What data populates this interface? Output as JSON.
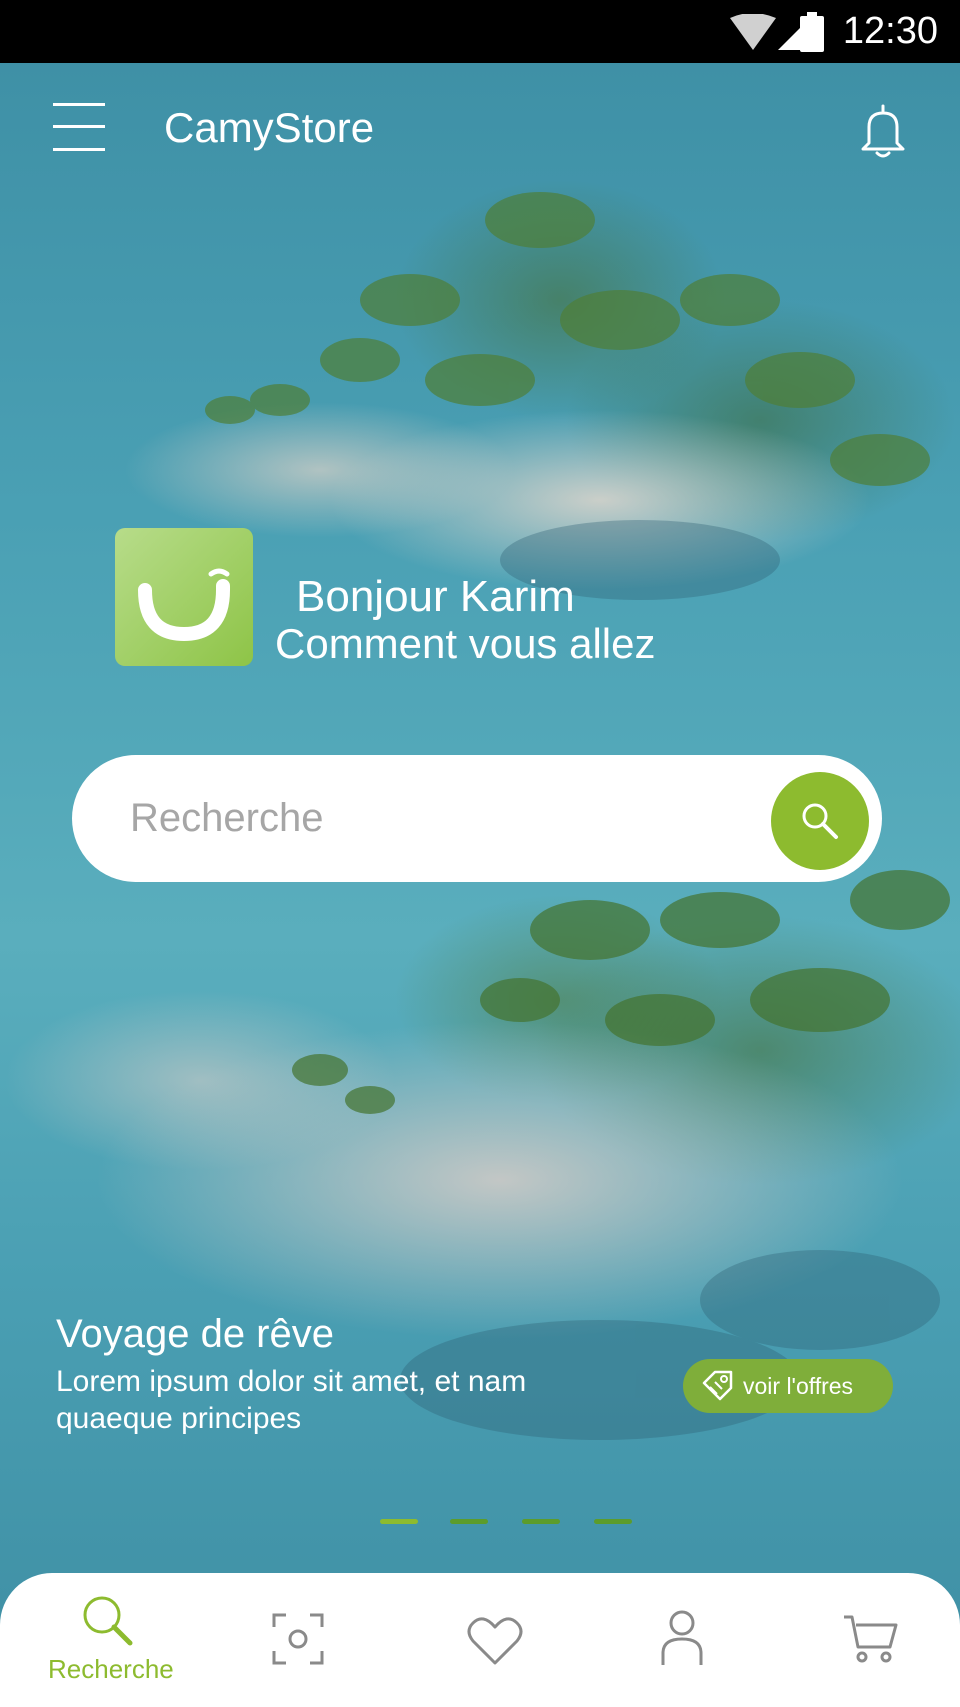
{
  "status_bar": {
    "time": "12:30",
    "icons": [
      "wifi-icon",
      "signal-icon",
      "battery-icon"
    ]
  },
  "header": {
    "title": "CamyStore",
    "menu_icon": "menu-icon",
    "notification_icon": "bell-icon"
  },
  "greeting": {
    "name": "Bonjour Karim",
    "subtitle": "Comment vous allez"
  },
  "search": {
    "placeholder": "Recherche",
    "value": ""
  },
  "promo": {
    "title": "Voyage de rêve",
    "description": "Lorem ipsum dolor sit amet, et nam quaeque principes",
    "button_label": "voir l'offres",
    "slides_count": 4,
    "active_slide": 1
  },
  "bottom_nav": {
    "items": [
      {
        "label": "Recherche",
        "icon": "search-icon",
        "active": true
      },
      {
        "label": "",
        "icon": "scan-icon",
        "active": false
      },
      {
        "label": "",
        "icon": "heart-icon",
        "active": false
      },
      {
        "label": "",
        "icon": "user-icon",
        "active": false
      },
      {
        "label": "",
        "icon": "cart-icon",
        "active": false
      }
    ]
  },
  "colors": {
    "accent": "#8dbb2f",
    "accent_dark": "#7fae3a",
    "text_light": "#ffffff",
    "icon_gray": "#8a8a8a"
  }
}
